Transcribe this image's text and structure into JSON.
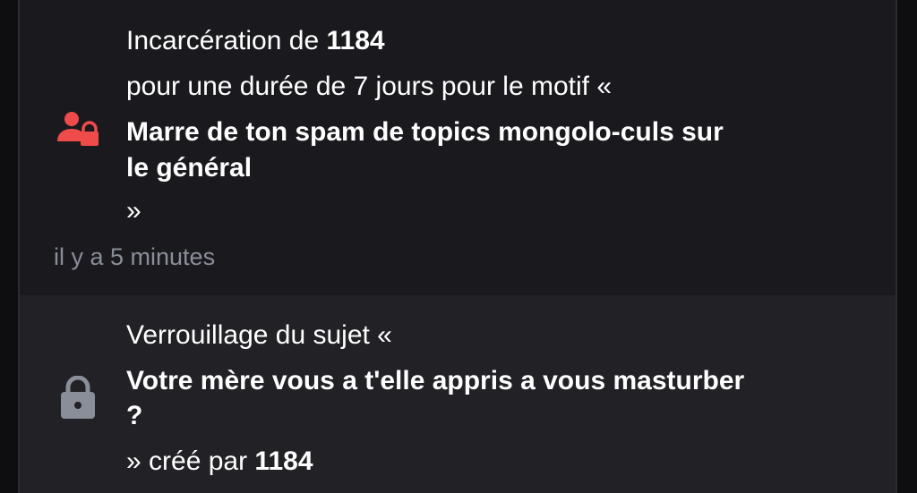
{
  "colors": {
    "accent_red": "#ef4b4b",
    "lock_gray": "#8a8e99",
    "muted_text": "#8b8e99"
  },
  "notifications": [
    {
      "icon": "user-lock-icon",
      "title_prefix": "Incarcération de",
      "user": "1184",
      "detail": "pour une durée de 7 jours pour le motif «",
      "reason_line1": "Marre de ton spam de topics mongolo-culs sur",
      "reason_line2": "le général",
      "close_quote": "»",
      "time": "il y a 5 minutes"
    },
    {
      "icon": "lock-icon",
      "title": "Verrouillage du sujet «",
      "subject_line1": "Votre mère vous a t'elle appris a vous masturber",
      "subject_line2": "?",
      "created_by_prefix": "» créé par",
      "author": "1184"
    }
  ]
}
